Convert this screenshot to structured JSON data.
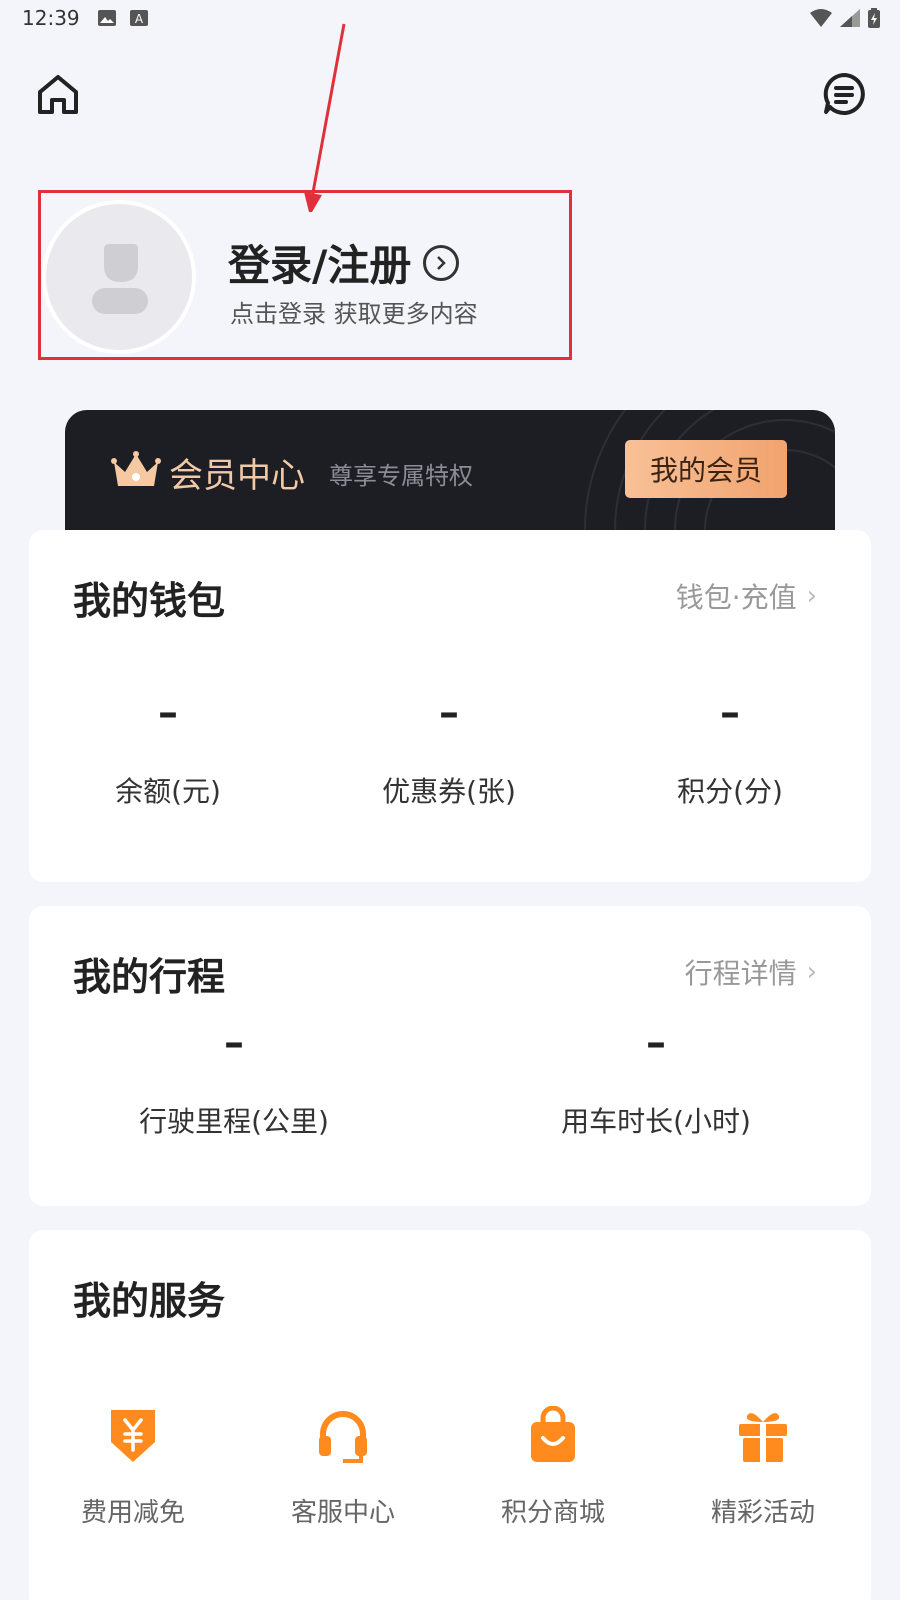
{
  "status_bar": {
    "time": "12:39"
  },
  "header": {
    "home_icon": "home-icon",
    "message_icon": "message-icon"
  },
  "profile": {
    "login_label": "登录/注册",
    "login_hint": "点击登录 获取更多内容"
  },
  "vip": {
    "title": "会员中心",
    "subtitle": "尊享专属特权",
    "button_label": "我的会员",
    "colors": {
      "card_bg": "#1d1e24",
      "title": "#f2c9a6",
      "button": "#f4b07f"
    }
  },
  "wallet": {
    "title": "我的钱包",
    "link_label": "钱包·充值",
    "stats": [
      {
        "value": "–",
        "label": "余额(元)"
      },
      {
        "value": "–",
        "label": "优惠券(张)"
      },
      {
        "value": "–",
        "label": "积分(分)"
      }
    ]
  },
  "trips": {
    "title": "我的行程",
    "link_label": "行程详情",
    "stats": [
      {
        "value": "–",
        "label": "行驶里程(公里)"
      },
      {
        "value": "–",
        "label": "用车时长(小时)"
      }
    ]
  },
  "services": {
    "title": "我的服务",
    "items": [
      {
        "label": "费用减免",
        "icon": "fee-waiver-icon"
      },
      {
        "label": "客服中心",
        "icon": "headset-icon"
      },
      {
        "label": "积分商城",
        "icon": "shopping-bag-icon"
      },
      {
        "label": "精彩活动",
        "icon": "gift-icon"
      }
    ],
    "accent_color": "#ff8a1e"
  }
}
